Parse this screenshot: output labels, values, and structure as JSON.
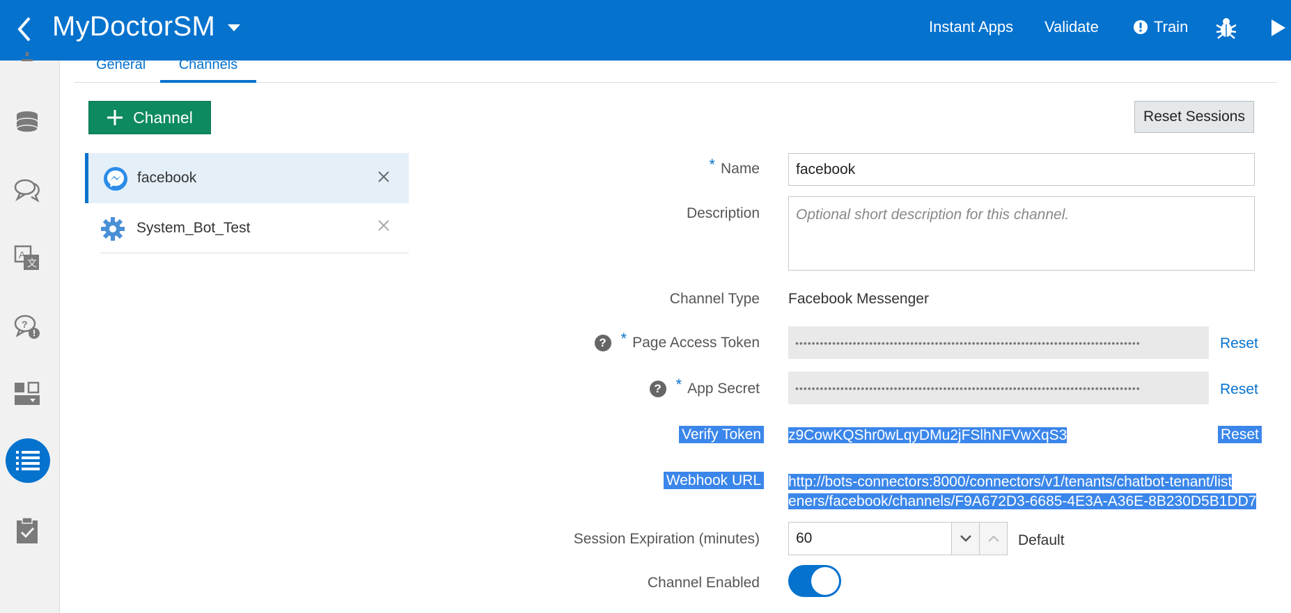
{
  "header": {
    "title": "MyDoctorSM",
    "instant_apps": "Instant Apps",
    "validate": "Validate",
    "train": "Train"
  },
  "tabs": [
    {
      "label": "General"
    },
    {
      "label": "Channels"
    }
  ],
  "toolbar": {
    "add_channel": "Channel",
    "reset_sessions": "Reset Sessions"
  },
  "channels": [
    {
      "label": "facebook",
      "icon": "messenger-icon"
    },
    {
      "label": "System_Bot_Test",
      "icon": "gear-icon"
    }
  ],
  "form": {
    "name_label": "Name",
    "name_value": "facebook",
    "description_label": "Description",
    "description_placeholder": "Optional short description for this channel.",
    "channel_type_label": "Channel Type",
    "channel_type_value": "Facebook Messenger",
    "page_access_token_label": "Page Access Token",
    "page_access_token_value": "••••••••••••••••••••••••••••••••••••••••••••••••••••••••••••••••••••••••••••••••••••",
    "app_secret_label": "App Secret",
    "app_secret_value": "••••••••••••••••••••••••••••••••••••••••••••••••••••••••••••••••••••••••••••••••••••",
    "verify_token_label": "Verify Token",
    "verify_token_value": "z9CowKQShr0wLqyDMu2jFSlhNFVwXqS3",
    "webhook_url_label": "Webhook URL",
    "webhook_url_line1": "http://bots-connectors:8000/connectors/v1/tenants/chatbot-tenant/list",
    "webhook_url_line2": "eners/facebook/channels/F9A672D3-6685-4E3A-A36E-8B230D5B1DD7",
    "session_expiration_label": "Session Expiration (minutes)",
    "session_expiration_value": "60",
    "session_default": "Default",
    "channel_enabled_label": "Channel Enabled",
    "channel_enabled": true,
    "reset": "Reset",
    "required_mark": "*",
    "help_mark": "?"
  },
  "colors": {
    "brand": "#0572ce",
    "add_button": "#0d8a5f",
    "selection_highlight": "#3b86ea"
  }
}
